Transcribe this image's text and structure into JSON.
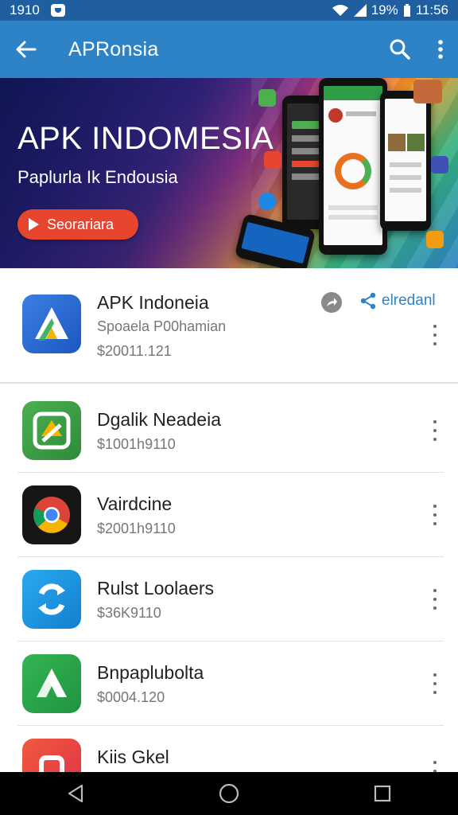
{
  "status_bar": {
    "time_left": "1910",
    "battery": "19%",
    "time_right": "11:56"
  },
  "app_bar": {
    "title": "APRonsia"
  },
  "banner": {
    "title": "APK INDOMESIA",
    "subtitle": "Paplurla Ik Endousia",
    "button_label": "Seorariara"
  },
  "featured": {
    "name": "APK Indoneia",
    "subtitle": "Spoaela P00hamian",
    "price": "$20011.121",
    "share_label": "elredanl"
  },
  "apps": [
    {
      "name": "Dgalik Neadeia",
      "price": "$1001h9110",
      "icon_color": "#3aa54a"
    },
    {
      "name": "Vairdcine",
      "price": "$2001h9110",
      "icon_color": "#1a1a1a"
    },
    {
      "name": "Rulst Loolaers",
      "price": "$36K9110",
      "icon_color": "#1e9be0"
    },
    {
      "name": "Bnpaplubolta",
      "price": "$0004.120",
      "icon_color": "#2aa34a"
    },
    {
      "name": "Kiis Gkel",
      "price": "",
      "icon_color": "#e5453a"
    }
  ],
  "colors": {
    "appbar": "#2d83c6",
    "statusbar": "#1f5f9f",
    "accent_button": "#e8452f"
  }
}
